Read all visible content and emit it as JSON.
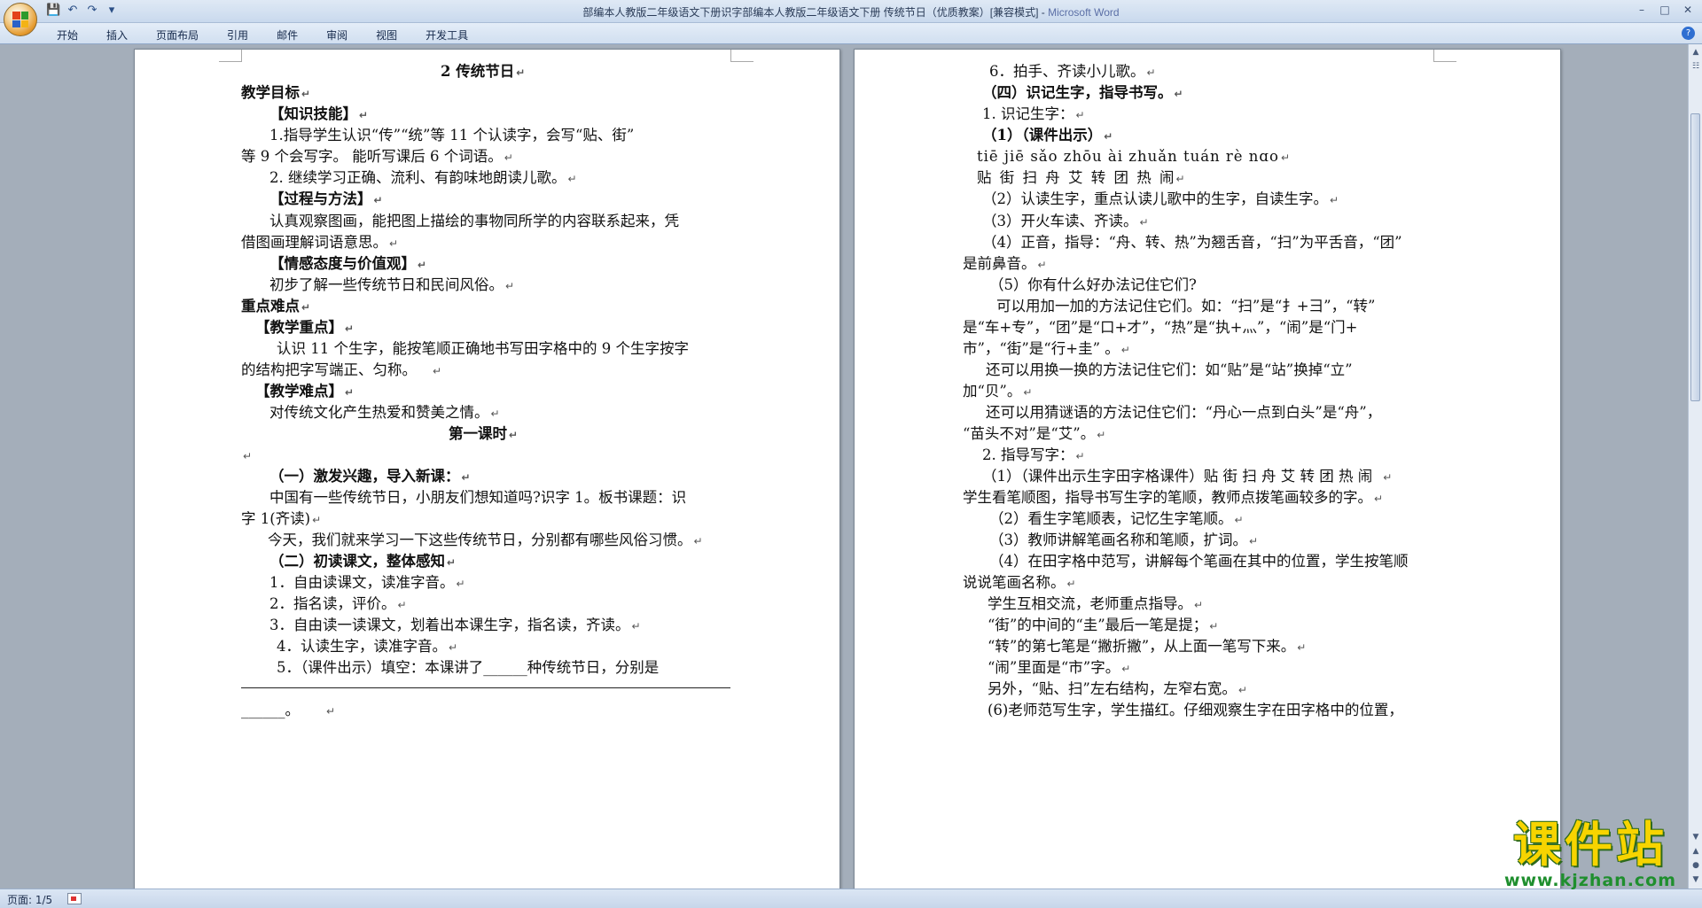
{
  "window": {
    "title": "部编本人教版二年级语文下册识字部编本人教版二年级语文下册 传统节日（优质教案）[兼容模式] - ",
    "app_name": "Microsoft Word"
  },
  "quick_access": [
    "save-icon",
    "undo-icon",
    "redo-icon",
    "customize-icon"
  ],
  "ribbon": {
    "tabs": [
      "开始",
      "插入",
      "页面布局",
      "引用",
      "邮件",
      "审阅",
      "视图",
      "开发工具"
    ]
  },
  "left_page": {
    "lines": [
      "2 传统节日",
      "教学目标",
      "【知识技能】",
      "1.指导学生认识“传”“统”等 11 个认读字，会写“贴、街”",
      "等 9 个会写字。 能听写课后 6 个词语。",
      "2. 继续学习正确、流利、有韵味地朗读儿歌。",
      "【过程与方法】",
      "认真观察图画，能把图上描绘的事物同所学的内容联系起来，凭",
      "借图画理解词语意思。",
      "【情感态度与价值观】",
      "初步了解一些传统节日和民间风俗。",
      "重点难点",
      "【教学重点】",
      "认识 11 个生字，能按笔顺正确地书写田字格中的 9 个生字按字",
      "的结构把字写端正、匀称。",
      "【教学难点】",
      "对传统文化产生热爱和赞美之情。",
      "第一课时",
      "",
      "（一）激发兴趣，导入新课：",
      "中国有一些传统节日，小朋友们想知道吗?识字 1。板书课题：识",
      "字 1(齐读)",
      "今天，我们就来学习一下这些传统节日，分别都有哪些风俗习惯。",
      "（二）初读课文，整体感知",
      "1．自由读课文，读准字音。",
      "2．指名读，评价。",
      "3．自由读一读课文，划着出本课生字，指名读，齐读。",
      "4．认读生字，读准字音。",
      "5．（课件出示）填空：本课讲了______种传统节日，分别是",
      "",
      "______。"
    ]
  },
  "right_page": {
    "lines": [
      "6．拍手、齐读小儿歌。",
      "（四）识记生字，指导书写。",
      "1. 识记生字：",
      "（1）（课件出示）",
      "tiē jiē sǎo zhōu ài zhuǎn tuán rè nɑo",
      "贴  街  扫  舟    艾 转     团    热 闹",
      "（2）认读生字，重点认读儿歌中的生字，自读生字。",
      "（3）开火车读、齐读。",
      "（4）正音，指导：“舟、转、热”为翘舌音，“扫”为平舌音，“团”",
      "是前鼻音。",
      "（5）你有什么好办法记住它们?",
      "可以用加一加的方法记住它们。如：“扫”是“扌+彐”，“转”",
      "是“车+专”，“团”是“口+才”，“热”是“执+灬”，“闹”是“门+",
      "市”，“街”是“行+圭”  。",
      "还可以用换一换的方法记住它们：如“贴”是“站”换掉“立”",
      "加“贝”。",
      "还可以用猜谜语的方法记住它们：“丹心一点到白头”是“舟”，",
      "“苗头不对”是“艾”。",
      "2. 指导写字：",
      "（1）（课件出示生字田字格课件）贴 街 扫 舟 艾 转 团 热 闹",
      "学生看笔顺图，指导书写生字的笔顺，教师点拨笔画较多的字。",
      "（2）看生字笔顺表，记忆生字笔顺。",
      "（3）教师讲解笔画名称和笔顺，扩词。",
      "（4）在田字格中范写，讲解每个笔画在其中的位置，学生按笔顺",
      "说说笔画名称。",
      "学生互相交流，老师重点指导。",
      "“街”的中间的“圭”最后一笔是提；",
      "“转”的第七笔是“撇折撇”，从上面一笔写下来。",
      "“闹”里面是“市”字。",
      "另外，“贴、扫”左右结构，左窄右宽。",
      "(6)老师范写生字，学生描红。仔细观察生字在田字格中的位置，"
    ]
  },
  "status": {
    "page_info": "页面: 1/5"
  },
  "watermark": {
    "main": "课件站",
    "url": "www.kjzhan.com"
  },
  "colors": {
    "title_bar": "#d6e3f3",
    "doc_background": "#a4aeba",
    "watermark_yellow": "#f7d400",
    "watermark_green": "#1f8f2e"
  }
}
